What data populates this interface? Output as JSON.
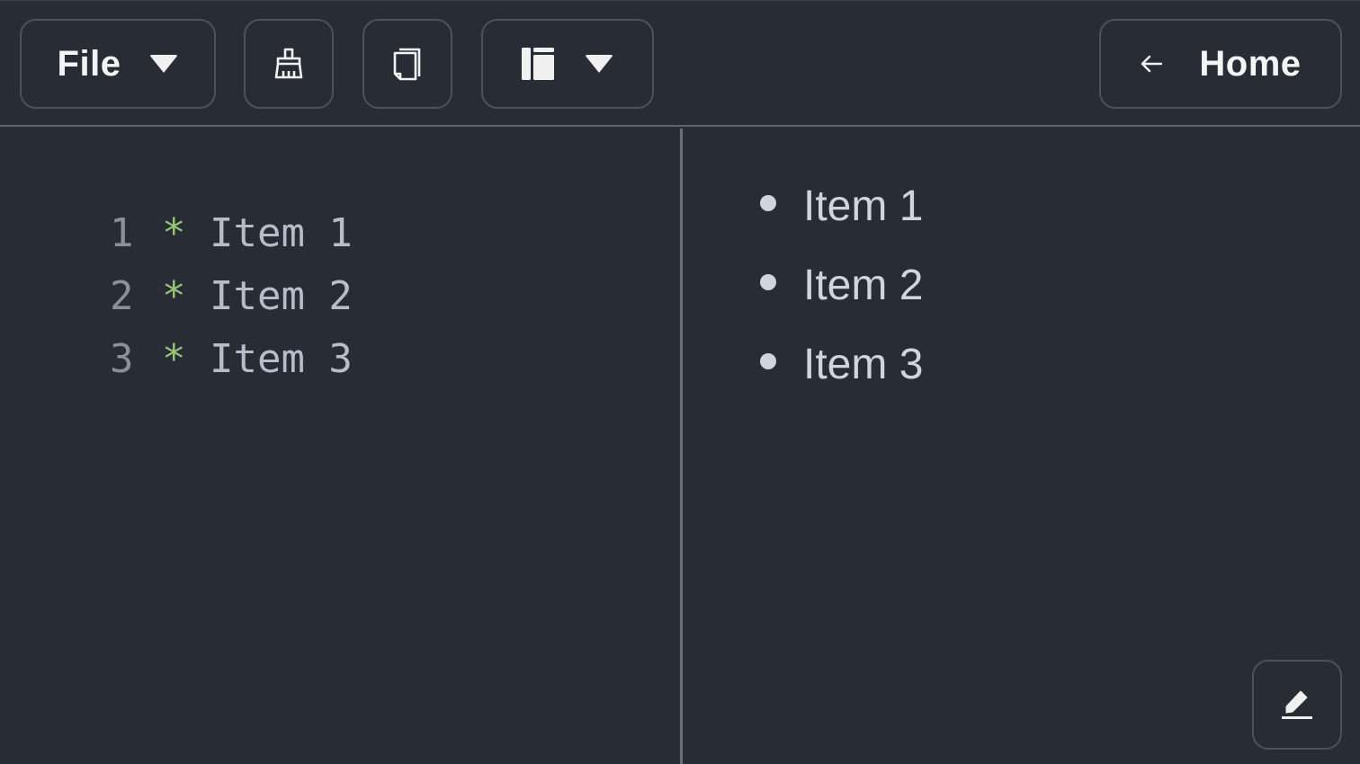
{
  "toolbar": {
    "file_label": "File",
    "file_icon": "chevron-down-icon",
    "clean_icon": "broom-icon",
    "copy_icon": "copy-icon",
    "layout_icon": "layout-sidebar-icon",
    "layout_caret_icon": "chevron-down-icon",
    "home_label": "Home",
    "home_icon": "arrow-left-icon"
  },
  "editor": {
    "lines": [
      {
        "number": "1",
        "bullet": "*",
        "text": "Item 1"
      },
      {
        "number": "2",
        "bullet": "*",
        "text": "Item 2"
      },
      {
        "number": "3",
        "bullet": "*",
        "text": "Item 3"
      }
    ]
  },
  "preview": {
    "items": [
      "Item 1",
      "Item 2",
      "Item 3"
    ]
  },
  "edit_button": {
    "icon": "pencil-icon"
  },
  "colors": {
    "background": "#282c35",
    "border": "#4d525c",
    "bullet_accent": "#98c379",
    "line_number": "#8a8f9c",
    "editor_text": "#b6bcc9",
    "preview_text": "#cfd4de"
  }
}
